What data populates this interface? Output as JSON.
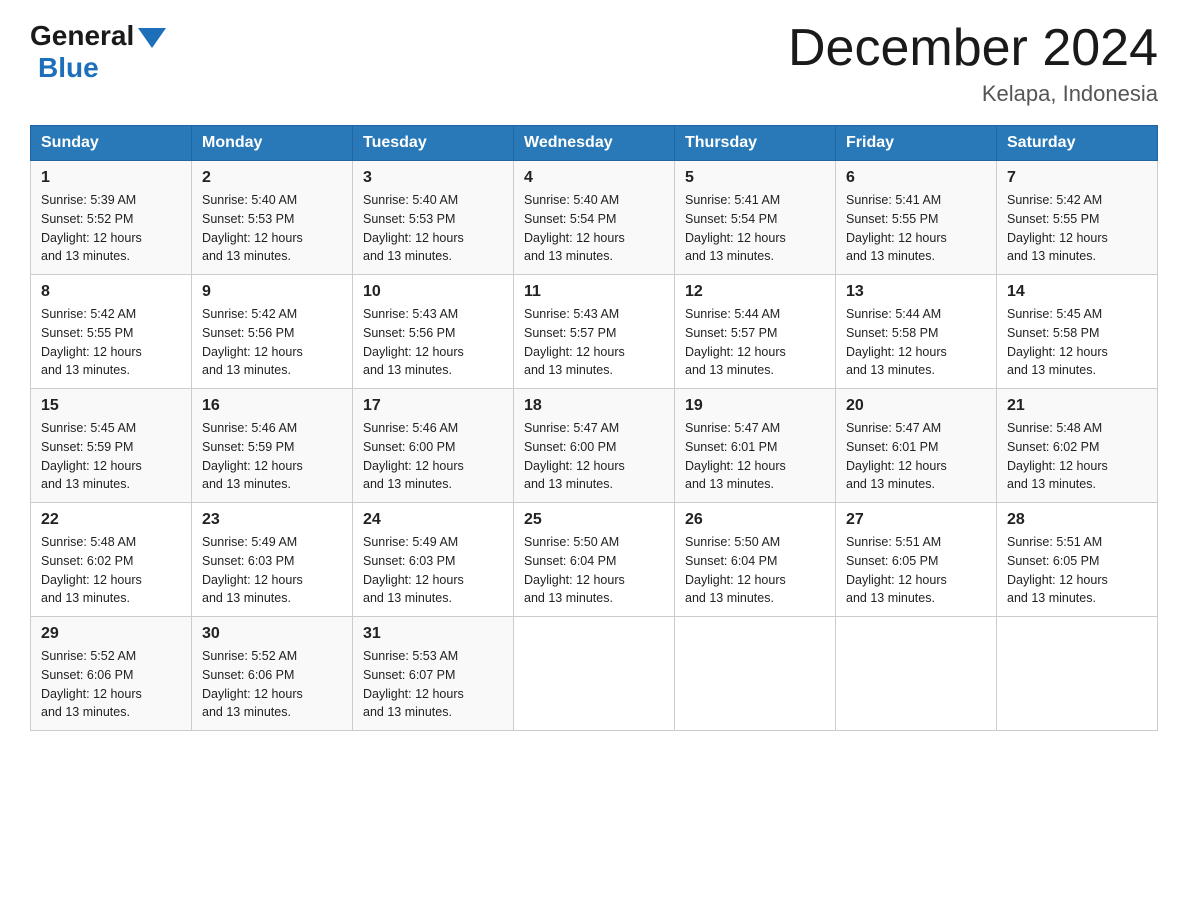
{
  "header": {
    "logo_general": "General",
    "logo_blue": "Blue",
    "title": "December 2024",
    "location": "Kelapa, Indonesia"
  },
  "days_of_week": [
    "Sunday",
    "Monday",
    "Tuesday",
    "Wednesday",
    "Thursday",
    "Friday",
    "Saturday"
  ],
  "weeks": [
    [
      {
        "day": "1",
        "sunrise": "5:39 AM",
        "sunset": "5:52 PM",
        "daylight": "12 hours and 13 minutes."
      },
      {
        "day": "2",
        "sunrise": "5:40 AM",
        "sunset": "5:53 PM",
        "daylight": "12 hours and 13 minutes."
      },
      {
        "day": "3",
        "sunrise": "5:40 AM",
        "sunset": "5:53 PM",
        "daylight": "12 hours and 13 minutes."
      },
      {
        "day": "4",
        "sunrise": "5:40 AM",
        "sunset": "5:54 PM",
        "daylight": "12 hours and 13 minutes."
      },
      {
        "day": "5",
        "sunrise": "5:41 AM",
        "sunset": "5:54 PM",
        "daylight": "12 hours and 13 minutes."
      },
      {
        "day": "6",
        "sunrise": "5:41 AM",
        "sunset": "5:55 PM",
        "daylight": "12 hours and 13 minutes."
      },
      {
        "day": "7",
        "sunrise": "5:42 AM",
        "sunset": "5:55 PM",
        "daylight": "12 hours and 13 minutes."
      }
    ],
    [
      {
        "day": "8",
        "sunrise": "5:42 AM",
        "sunset": "5:55 PM",
        "daylight": "12 hours and 13 minutes."
      },
      {
        "day": "9",
        "sunrise": "5:42 AM",
        "sunset": "5:56 PM",
        "daylight": "12 hours and 13 minutes."
      },
      {
        "day": "10",
        "sunrise": "5:43 AM",
        "sunset": "5:56 PM",
        "daylight": "12 hours and 13 minutes."
      },
      {
        "day": "11",
        "sunrise": "5:43 AM",
        "sunset": "5:57 PM",
        "daylight": "12 hours and 13 minutes."
      },
      {
        "day": "12",
        "sunrise": "5:44 AM",
        "sunset": "5:57 PM",
        "daylight": "12 hours and 13 minutes."
      },
      {
        "day": "13",
        "sunrise": "5:44 AM",
        "sunset": "5:58 PM",
        "daylight": "12 hours and 13 minutes."
      },
      {
        "day": "14",
        "sunrise": "5:45 AM",
        "sunset": "5:58 PM",
        "daylight": "12 hours and 13 minutes."
      }
    ],
    [
      {
        "day": "15",
        "sunrise": "5:45 AM",
        "sunset": "5:59 PM",
        "daylight": "12 hours and 13 minutes."
      },
      {
        "day": "16",
        "sunrise": "5:46 AM",
        "sunset": "5:59 PM",
        "daylight": "12 hours and 13 minutes."
      },
      {
        "day": "17",
        "sunrise": "5:46 AM",
        "sunset": "6:00 PM",
        "daylight": "12 hours and 13 minutes."
      },
      {
        "day": "18",
        "sunrise": "5:47 AM",
        "sunset": "6:00 PM",
        "daylight": "12 hours and 13 minutes."
      },
      {
        "day": "19",
        "sunrise": "5:47 AM",
        "sunset": "6:01 PM",
        "daylight": "12 hours and 13 minutes."
      },
      {
        "day": "20",
        "sunrise": "5:47 AM",
        "sunset": "6:01 PM",
        "daylight": "12 hours and 13 minutes."
      },
      {
        "day": "21",
        "sunrise": "5:48 AM",
        "sunset": "6:02 PM",
        "daylight": "12 hours and 13 minutes."
      }
    ],
    [
      {
        "day": "22",
        "sunrise": "5:48 AM",
        "sunset": "6:02 PM",
        "daylight": "12 hours and 13 minutes."
      },
      {
        "day": "23",
        "sunrise": "5:49 AM",
        "sunset": "6:03 PM",
        "daylight": "12 hours and 13 minutes."
      },
      {
        "day": "24",
        "sunrise": "5:49 AM",
        "sunset": "6:03 PM",
        "daylight": "12 hours and 13 minutes."
      },
      {
        "day": "25",
        "sunrise": "5:50 AM",
        "sunset": "6:04 PM",
        "daylight": "12 hours and 13 minutes."
      },
      {
        "day": "26",
        "sunrise": "5:50 AM",
        "sunset": "6:04 PM",
        "daylight": "12 hours and 13 minutes."
      },
      {
        "day": "27",
        "sunrise": "5:51 AM",
        "sunset": "6:05 PM",
        "daylight": "12 hours and 13 minutes."
      },
      {
        "day": "28",
        "sunrise": "5:51 AM",
        "sunset": "6:05 PM",
        "daylight": "12 hours and 13 minutes."
      }
    ],
    [
      {
        "day": "29",
        "sunrise": "5:52 AM",
        "sunset": "6:06 PM",
        "daylight": "12 hours and 13 minutes."
      },
      {
        "day": "30",
        "sunrise": "5:52 AM",
        "sunset": "6:06 PM",
        "daylight": "12 hours and 13 minutes."
      },
      {
        "day": "31",
        "sunrise": "5:53 AM",
        "sunset": "6:07 PM",
        "daylight": "12 hours and 13 minutes."
      },
      null,
      null,
      null,
      null
    ]
  ],
  "labels": {
    "sunrise_prefix": "Sunrise: ",
    "sunset_prefix": "Sunset: ",
    "daylight_prefix": "Daylight: "
  }
}
